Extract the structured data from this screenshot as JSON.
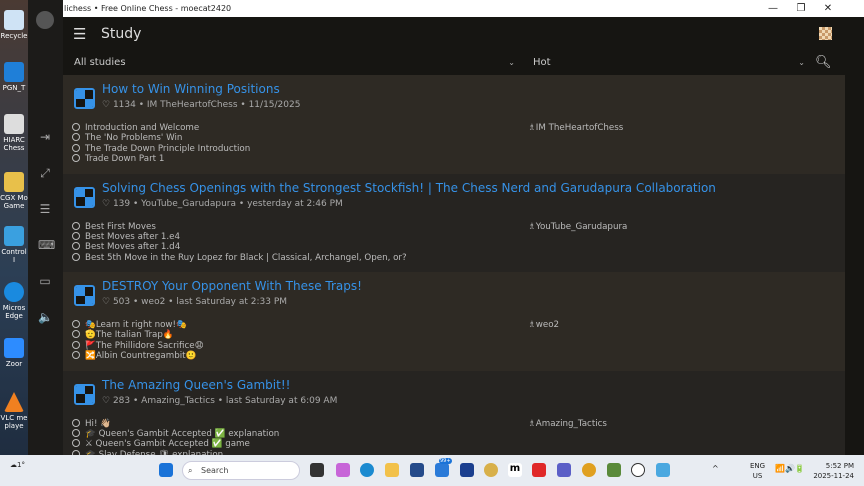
{
  "desktop": {
    "icons": [
      {
        "label": "Recycle"
      },
      {
        "label": "PGN_T"
      },
      {
        "label": "HIARC Chess"
      },
      {
        "label": "CGX Mo Game"
      },
      {
        "label": "Control I"
      },
      {
        "label": "Micros Edge"
      },
      {
        "label": "Zoor"
      },
      {
        "label": "VLC me playe"
      }
    ]
  },
  "window": {
    "title": "lichess • Free Online Chess - moecat2420"
  },
  "header": {
    "title": "Study"
  },
  "filters": {
    "scope": "All studies",
    "order": "Hot"
  },
  "studies": [
    {
      "title": "How to Win Winning Positions",
      "likes": "1134",
      "author": "IM TheHeartofChess",
      "date": "11/15/2025",
      "chapters": [
        "Introduction and Welcome",
        "The 'No Problems' Win",
        "The Trade Down Principle Introduction",
        "Trade Down Part 1"
      ],
      "member": "IM TheHeartofChess"
    },
    {
      "title": "Solving Chess Openings with the Strongest Stockfish! | The Chess Nerd and Garudapura Collaboration",
      "likes": "139",
      "author": "YouTube_Garudapura",
      "date": "yesterday at 2:46 PM",
      "chapters": [
        "Best First Moves",
        "Best Moves after 1.e4",
        "Best Moves after 1.d4",
        "Best 5th Move in the Ruy Lopez for Black | Classical, Archangel, Open, or?"
      ],
      "member": "YouTube_Garudapura"
    },
    {
      "title": "DESTROY Your Opponent With These Traps!",
      "likes": "503",
      "author": "weo2",
      "date": "last Saturday at 2:33 PM",
      "chapters": [
        "🎭Learn it right now!🎭",
        "🫡The Italian Trap🔥",
        "🚩The Phillidore Sacrifice😧",
        "🔀Albin Countregambit🙂"
      ],
      "member": "weo2"
    },
    {
      "title": "The Amazing Queen's Gambit!!",
      "likes": "283",
      "author": "Amazing_Tactics",
      "date": "last Saturday at 6:09 AM",
      "chapters": [
        "Hi! 👋🏼",
        "🎓 Queen's Gambit Accepted ✅ explanation",
        "⚔ Queen's Gambit Accepted ✅ game",
        "🎓 Slav Defense 🛡 explanation"
      ],
      "member": "Amazing_Tactics"
    }
  ],
  "taskbar": {
    "search_placeholder": "Search",
    "weather": "1°",
    "mail_badge": "99+",
    "lang": "ENG",
    "region": "US",
    "time": "5:52 PM",
    "date": "2025-11-24"
  },
  "colors": {
    "accent": "#3692e7",
    "background": "#161512"
  }
}
